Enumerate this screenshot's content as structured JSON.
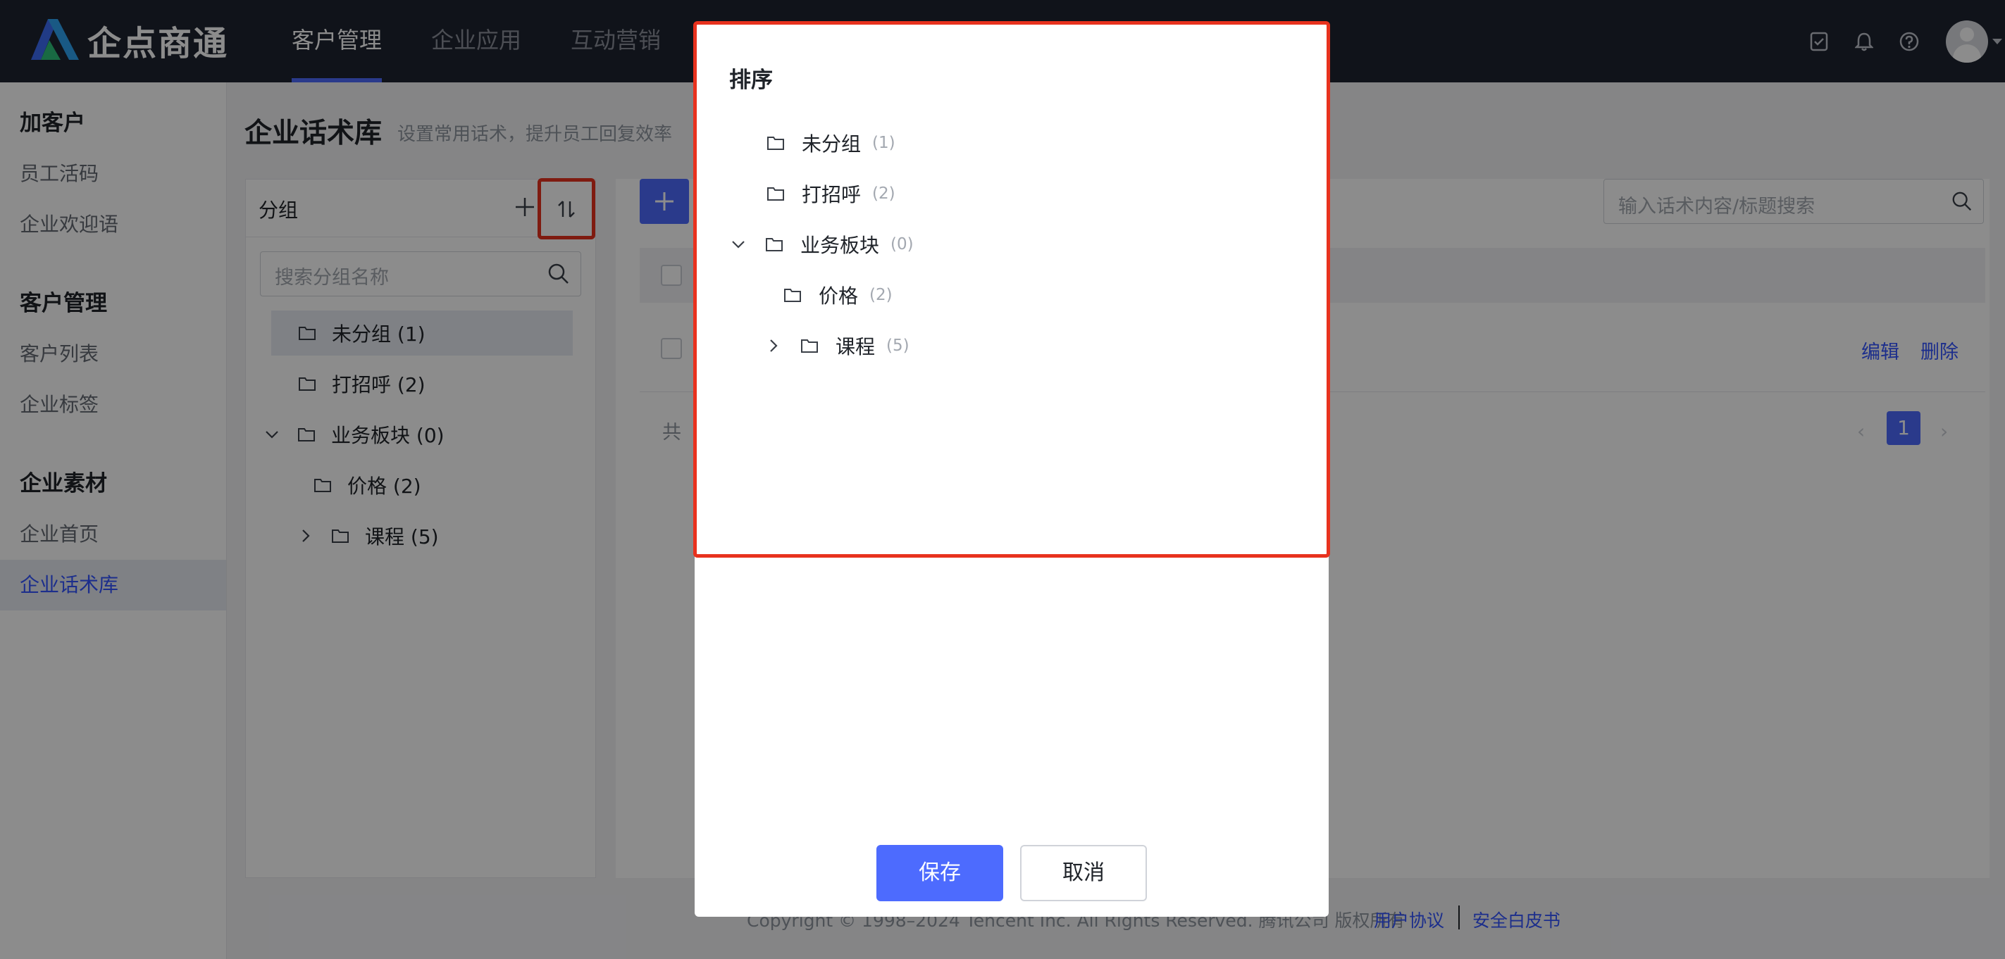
{
  "header": {
    "brand": "企点商通",
    "nav": [
      "客户管理",
      "企业应用",
      "互动营销"
    ],
    "icons": [
      "task-icon",
      "bell-icon",
      "help-icon",
      "avatar"
    ]
  },
  "sidebar": {
    "groups": [
      {
        "title": "加客户",
        "items": [
          "员工活码",
          "企业欢迎语"
        ]
      },
      {
        "title": "客户管理",
        "items": [
          "客户列表",
          "企业标签"
        ]
      },
      {
        "title": "企业素材",
        "items": [
          "企业首页",
          "企业话术库"
        ]
      }
    ],
    "active_item": "企业话术库"
  },
  "page": {
    "title": "企业话术库",
    "subtitle": "设置常用话术，提升员工回复效率"
  },
  "group_panel": {
    "title": "分组",
    "search_placeholder": "搜索分组名称",
    "tree": [
      {
        "label": "未分组 (1)"
      },
      {
        "label": "打招呼 (2)"
      },
      {
        "label": "业务板块 (0)"
      },
      {
        "label": "价格 (2)"
      },
      {
        "label": "课程 (5)"
      }
    ]
  },
  "content": {
    "search_placeholder": "输入话术内容/标题搜索",
    "row_actions": {
      "edit": "编辑",
      "delete": "删除"
    },
    "total_prefix": "共",
    "current_page": "1"
  },
  "footer": {
    "copyright": "Copyright © 1998–2024 Tencent Inc. All Rights Reserved. 腾讯公司 版权所有",
    "links": [
      "用户协议",
      "安全白皮书"
    ]
  },
  "modal": {
    "title": "排序",
    "tree": [
      {
        "name": "未分组",
        "count": "(1)"
      },
      {
        "name": "打招呼",
        "count": "(2)"
      },
      {
        "name": "业务板块",
        "count": "(0)"
      },
      {
        "name": "价格",
        "count": "(2)"
      },
      {
        "name": "课程",
        "count": "(5)"
      }
    ],
    "save_label": "保存",
    "cancel_label": "取消"
  },
  "colors": {
    "accent": "#4d6bfe",
    "highlight": "#e8321e",
    "header_bg": "#1e2330"
  }
}
